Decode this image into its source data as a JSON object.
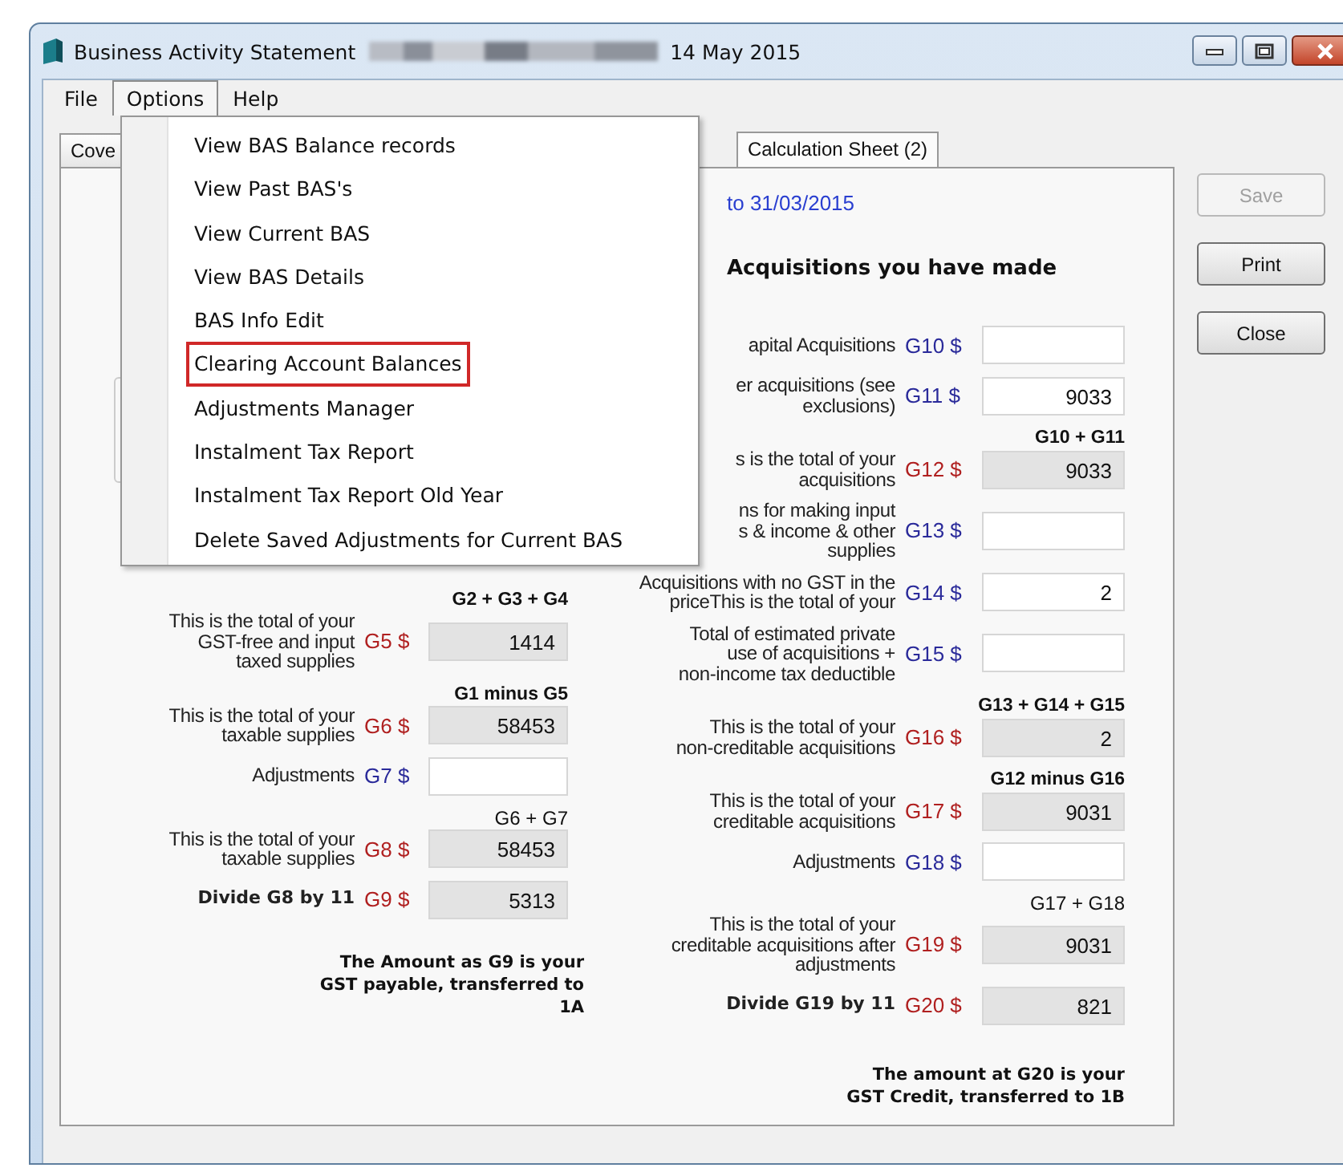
{
  "window": {
    "title": "Business Activity Statement",
    "title_redacted": true,
    "title_date": "14 May 2015"
  },
  "menubar": [
    {
      "label": "File",
      "selected": false
    },
    {
      "label": "Options",
      "selected": true
    },
    {
      "label": "Help",
      "selected": false
    }
  ],
  "tabs": [
    {
      "label": "Cove",
      "selected": false
    },
    {
      "label": "Calculation Sheet (2)",
      "selected": true
    }
  ],
  "options_menu": [
    {
      "label": "View BAS Balance records",
      "highlighted": false
    },
    {
      "label": "View Past BAS's",
      "highlighted": false
    },
    {
      "label": "View Current BAS",
      "highlighted": false
    },
    {
      "label": "View BAS Details",
      "highlighted": false
    },
    {
      "label": "BAS Info Edit",
      "highlighted": false
    },
    {
      "label": "Clearing Account Balances",
      "highlighted": true
    },
    {
      "label": "Adjustments Manager",
      "highlighted": false
    },
    {
      "label": "Instalment Tax Report",
      "highlighted": false
    },
    {
      "label": "Instalment Tax Report Old Year",
      "highlighted": false
    },
    {
      "label": "Delete Saved Adjustments for Current BAS",
      "highlighted": false
    }
  ],
  "period": "to 31/03/2015",
  "supplies_rows": [
    {
      "formula": "G2 + G3 + G4",
      "formula_bold": true,
      "label": [
        "This is the total of your",
        "GST-free and input",
        "taxed supplies"
      ],
      "label_bold": false,
      "code": "G5 $",
      "kind": "computed",
      "value": "1414"
    },
    {
      "formula": "G1 minus G5",
      "formula_bold": true,
      "label": [
        "This is the total of your",
        "taxable supplies"
      ],
      "label_bold": false,
      "code": "G6 $",
      "kind": "computed",
      "value": "58453"
    },
    {
      "label": [
        "Adjustments"
      ],
      "label_bold": false,
      "code": "G7 $",
      "kind": "input"
    },
    {
      "formula": "G6 + G7",
      "formula_bold": false,
      "label": [
        "This is the total of your",
        "taxable supplies"
      ],
      "label_bold": false,
      "code": "G8 $",
      "kind": "computed",
      "value": "58453"
    },
    {
      "label": [
        "Divide G8 by 11"
      ],
      "label_bold": true,
      "code": "G9 $",
      "kind": "computed",
      "value": "5313"
    }
  ],
  "supplies_note": [
    "The Amount as G9 is your",
    "GST payable, transferred to",
    "1A"
  ],
  "acquisitions_heading": "Acquisitions you have made",
  "acquisitions_rows": [
    {
      "label": [
        "apital Acquisitions"
      ],
      "label_bold": false,
      "code": "G10 $",
      "kind": "input"
    },
    {
      "label": [
        "er acquisitions (see",
        "exclusions)"
      ],
      "label_bold": false,
      "code": "G11 $",
      "kind": "input",
      "value": "9033"
    },
    {
      "formula": "G10 + G11",
      "formula_bold": true,
      "label": [
        "s is the total of your",
        "acquisitions"
      ],
      "label_bold": false,
      "code": "G12 $",
      "kind": "computed",
      "value": "9033"
    },
    {
      "label": [
        "ns for making input",
        "s & income & other",
        "supplies"
      ],
      "label_bold": false,
      "code": "G13 $",
      "kind": "input"
    },
    {
      "label": [
        "Acquisitions with no GST in the",
        "priceThis is the total of your"
      ],
      "label_bold": false,
      "code": "G14 $",
      "kind": "input",
      "value": "2"
    },
    {
      "label": [
        "Total of estimated private",
        "use of acquisitions +",
        "non-income tax deductible"
      ],
      "label_bold": false,
      "code": "G15 $",
      "kind": "input"
    },
    {
      "formula": "G13 + G14 + G15",
      "formula_bold": true,
      "label": [
        "This is the total of your",
        "non-creditable acquisitions"
      ],
      "label_bold": false,
      "code": "G16 $",
      "kind": "computed",
      "value": "2"
    },
    {
      "formula": "G12 minus G16",
      "formula_bold": true,
      "label": [
        "This is the total of your",
        "creditable acquisitions"
      ],
      "label_bold": false,
      "code": "G17 $",
      "kind": "computed",
      "value": "9031"
    },
    {
      "label": [
        "Adjustments"
      ],
      "label_bold": false,
      "code": "G18 $",
      "kind": "input"
    },
    {
      "formula": "G17 + G18",
      "formula_bold": false,
      "label": [
        "This is the total of your",
        "creditable acquisitions after",
        "adjustments"
      ],
      "label_bold": false,
      "code": "G19 $",
      "kind": "computed",
      "value": "9031"
    },
    {
      "label": [
        "Divide G19 by 11"
      ],
      "label_bold": true,
      "code": "G20 $",
      "kind": "computed",
      "value": "821"
    }
  ],
  "acquisitions_note": [
    "The amount at G20 is your",
    "GST Credit, transferred to 1B"
  ],
  "buttons": [
    {
      "label": "Save",
      "disabled": true
    },
    {
      "label": "Print",
      "disabled": false
    },
    {
      "label": "Close",
      "disabled": false
    }
  ]
}
